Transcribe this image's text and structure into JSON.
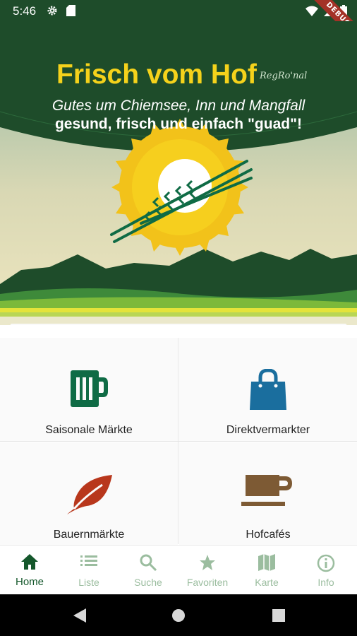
{
  "status_bar": {
    "time": "5:46",
    "icons": [
      "gear-icon",
      "sd-card-icon",
      "wifi-icon",
      "signal-icon",
      "battery-icon"
    ],
    "debug_banner": "DEBUG"
  },
  "hero": {
    "title": "Frisch vom Hof",
    "brand": "RegRo'nal",
    "tagline1": "Gutes um Chiemsee, Inn und Mangfall",
    "tagline2": "gesund, frisch und einfach \"guad\"!"
  },
  "menu": {
    "items": [
      {
        "label": "Saisonale Märkte",
        "icon": "beer-mug-icon",
        "color": "#0f6b45"
      },
      {
        "label": "Direktvermarkter",
        "icon": "shopping-bag-icon",
        "color": "#1a6e9e"
      },
      {
        "label": "Bauernmärkte",
        "icon": "leaf-icon",
        "color": "#b8371c"
      },
      {
        "label": "Hofcafés",
        "icon": "coffee-cup-icon",
        "color": "#7d5a34"
      }
    ]
  },
  "bottom_nav": {
    "items": [
      {
        "label": "Home",
        "icon": "home-icon",
        "active": true
      },
      {
        "label": "Liste",
        "icon": "list-icon",
        "active": false
      },
      {
        "label": "Suche",
        "icon": "search-icon",
        "active": false
      },
      {
        "label": "Favoriten",
        "icon": "star-icon",
        "active": false
      },
      {
        "label": "Karte",
        "icon": "map-icon",
        "active": false
      },
      {
        "label": "Info",
        "icon": "info-icon",
        "active": false
      }
    ]
  },
  "colors": {
    "brand_green": "#1e4c2a",
    "accent_yellow": "#f5d21b",
    "nav_active": "#14572b",
    "nav_inactive": "#9bbd9f"
  }
}
